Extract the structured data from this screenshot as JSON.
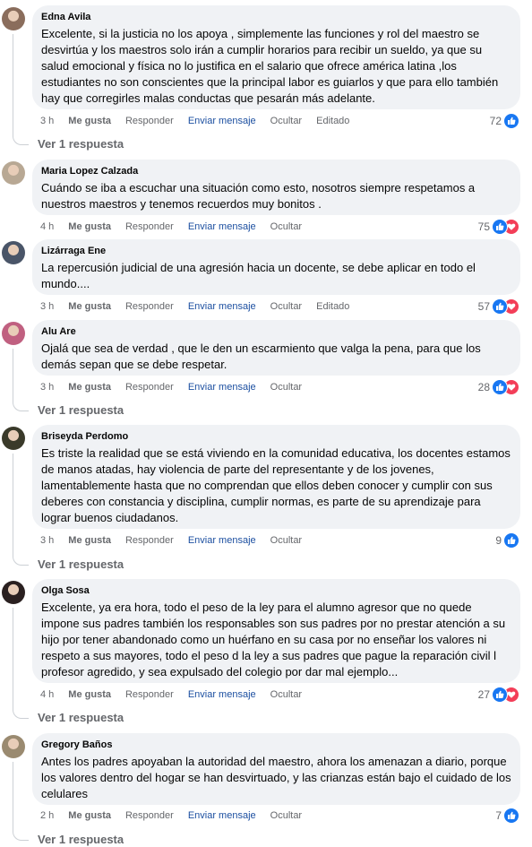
{
  "labels": {
    "like": "Me gusta",
    "reply": "Responder",
    "message": "Enviar mensaje",
    "hide": "Ocultar",
    "edited": "Editado"
  },
  "comments": [
    {
      "author": "Edna Avila",
      "text": "Excelente, si la justicia no los apoya , simplemente las funciones y rol del maestro se desvirtúa y los maestros solo irán a cumplir horarios para recibir un sueldo, ya que su salud emocional y física no lo justifica en el salario que ofrece américa latina ,los estudiantes no son conscientes que la principal labor es guiarlos y que para ello también hay que corregirles malas conductas que pesarán más adelante.",
      "time": "3 h",
      "edited": "Editado",
      "reaction_count": "72",
      "reactions": [
        "like-icon"
      ],
      "replies": "Ver 1 respuesta"
    },
    {
      "author": "Maria Lopez Calzada",
      "text": "Cuándo se iba a escuchar una situación como esto, nosotros siempre respetamos a nuestros maestros y tenemos recuerdos muy bonitos .",
      "time": "4 h",
      "edited": "",
      "reaction_count": "75",
      "reactions": [
        "like-icon",
        "love-icon"
      ],
      "replies": ""
    },
    {
      "author": "Lizárraga Ene",
      "text": "La repercusión judicial de una agresión hacia un docente, se debe aplicar en todo el mundo....",
      "time": "3 h",
      "edited": "Editado",
      "reaction_count": "57",
      "reactions": [
        "like-icon",
        "love-icon"
      ],
      "replies": ""
    },
    {
      "author": "Alu Are",
      "text": "Ojalá que sea de verdad , que le den un escarmiento que valga la pena, para que los demás sepan que se debe respetar.",
      "time": "3 h",
      "edited": "",
      "reaction_count": "28",
      "reactions": [
        "like-icon",
        "love-icon"
      ],
      "replies": "Ver 1 respuesta"
    },
    {
      "author": "Briseyda Perdomo",
      "text": "Es triste la realidad que se está viviendo en la comunidad educativa, los docentes estamos de manos atadas, hay violencia de parte del representante y de los jovenes, lamentablemente hasta que no comprendan que ellos deben conocer y cumplir con sus deberes con constancia y disciplina, cumplir normas, es parte de su aprendizaje para lograr buenos ciudadanos.",
      "time": "3 h",
      "edited": "",
      "reaction_count": "9",
      "reactions": [
        "like-icon"
      ],
      "replies": "Ver 1 respuesta"
    },
    {
      "author": "Olga Sosa",
      "text": "Excelente, ya era hora, todo el peso de la ley para el alumno agresor que no quede impone sus padres también los responsables son sus padres por no prestar atención a su hijo por tener abandonado como un huérfano en su casa por no enseñar los valores ni respeto a sus mayores, todo el peso d la ley a sus padres que pague la reparación civil l profesor agredido, y sea expulsado del colegio por dar mal ejemplo...",
      "time": "4 h",
      "edited": "",
      "reaction_count": "27",
      "reactions": [
        "like-icon",
        "love-icon"
      ],
      "replies": "Ver 1 respuesta"
    },
    {
      "author": "Gregory Baños",
      "text": "Antes los padres apoyaban la autoridad del maestro, ahora los amenazan a diario, porque los valores dentro del hogar se han desvirtuado, y las crianzas están bajo el cuidado de los celulares",
      "time": "2 h",
      "edited": "",
      "reaction_count": "7",
      "reactions": [
        "like-icon"
      ],
      "replies": "Ver 1 respuesta"
    }
  ],
  "colors": {
    "bubble": "#f0f2f5",
    "meta": "#65676b",
    "link": "#1c4fa0",
    "like": "#1877f2",
    "love": "#f33e58"
  }
}
